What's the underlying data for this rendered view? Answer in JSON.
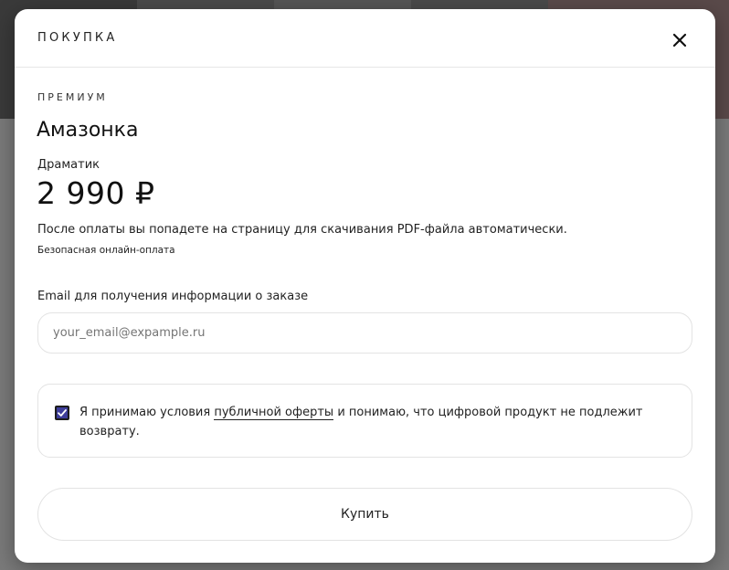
{
  "modal": {
    "title": "ПОКУПКА",
    "close_icon": "close-icon"
  },
  "product": {
    "tier": "ПРЕМИУМ",
    "title": "Амазонка",
    "subtitle": "Драматик",
    "price": "2 990 ₽",
    "info": "После оплаты вы попадете на страницу для скачивания PDF-файла автоматически.",
    "secure_payment": "Безопасная онлайн-оплата"
  },
  "form": {
    "email_label": "Email для получения информации о заказе",
    "email_placeholder": "your_email@expample.ru",
    "consent": {
      "checked": true,
      "text_before": "Я принимаю условия ",
      "link_text": "публичной оферты",
      "text_after": " и понимаю, что цифровой продукт не подлежит возврату."
    },
    "buy_label": "Купить"
  },
  "colors": {
    "checkbox_fill": "#3d3d9a",
    "backdrop": "#6b6b6b"
  }
}
